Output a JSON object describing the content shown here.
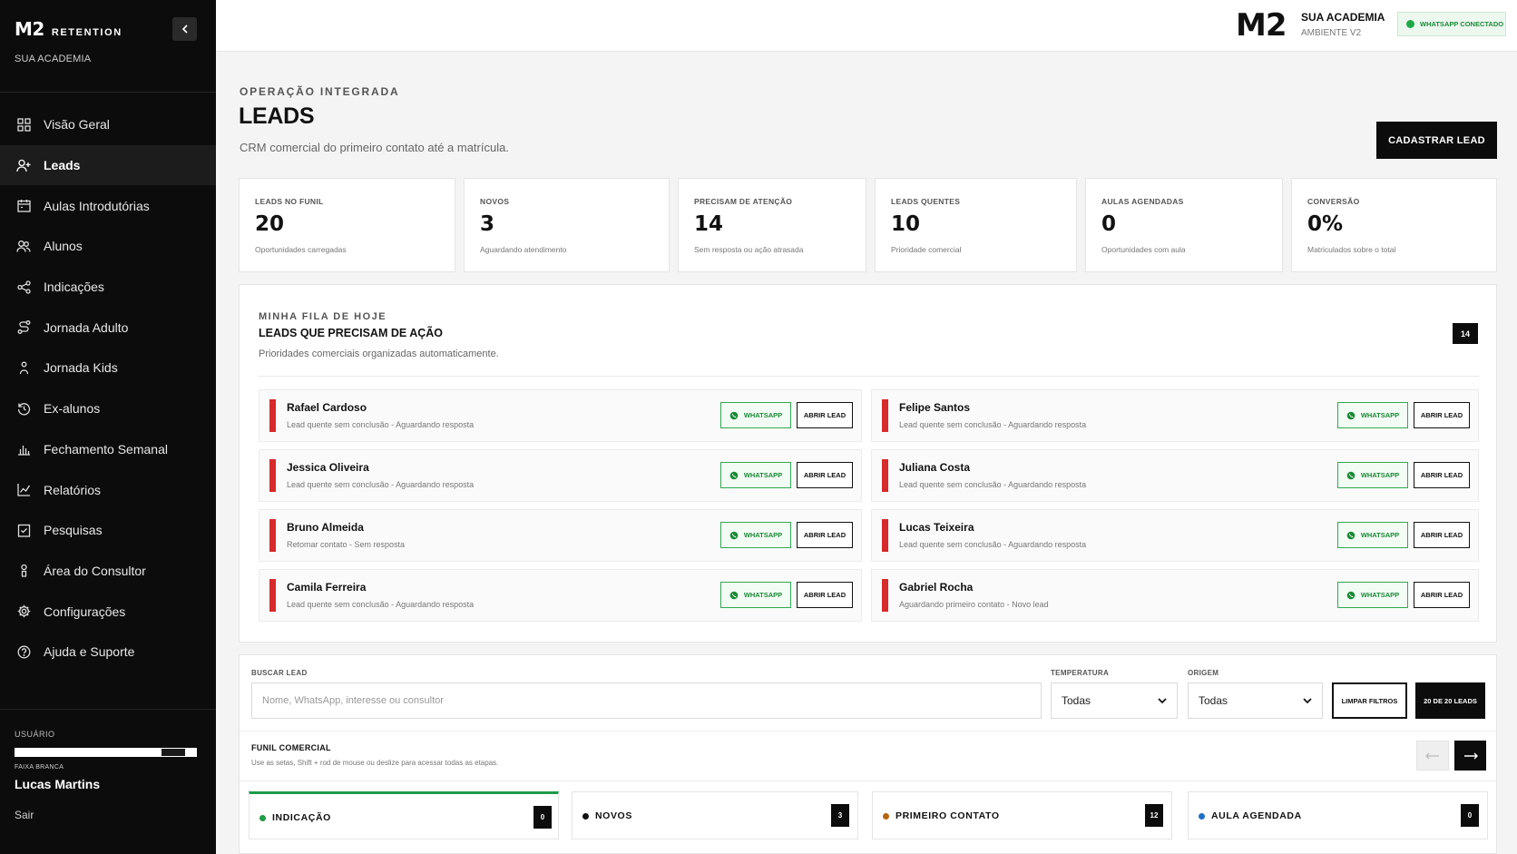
{
  "sidebar": {
    "brand_mark": "M2",
    "brand_word": "RETENTION",
    "academy": "SUA ACADEMIA",
    "items": [
      {
        "label": "Visão Geral",
        "icon": "grid-icon"
      },
      {
        "label": "Leads",
        "icon": "user-plus-icon"
      },
      {
        "label": "Aulas Introdutórias",
        "icon": "calendar-icon"
      },
      {
        "label": "Alunos",
        "icon": "users-icon"
      },
      {
        "label": "Indicações",
        "icon": "share-icon"
      },
      {
        "label": "Jornada Adulto",
        "icon": "route-icon"
      },
      {
        "label": "Jornada Kids",
        "icon": "child-icon"
      },
      {
        "label": "Ex-alunos",
        "icon": "history-icon"
      },
      {
        "label": "Fechamento Semanal",
        "icon": "bar-chart-icon"
      },
      {
        "label": "Relatórios",
        "icon": "line-chart-icon"
      },
      {
        "label": "Pesquisas",
        "icon": "clipboard-check-icon"
      },
      {
        "label": "Área do Consultor",
        "icon": "consultant-icon"
      },
      {
        "label": "Configurações",
        "icon": "gear-icon"
      },
      {
        "label": "Ajuda e Suporte",
        "icon": "help-icon"
      }
    ],
    "active_item": "Leads",
    "user_label": "USUÁRIO",
    "belt_label": "FAIXA BRANCA",
    "user_name": "Lucas Martins",
    "logout": "Sair"
  },
  "topbar": {
    "logo": "M2",
    "academy": "SUA ACADEMIA",
    "environment": "AMBIENTE V2",
    "whatsapp_status": "WHATSAPP CONECTADO"
  },
  "header": {
    "kicker": "OPERAÇÃO INTEGRADA",
    "title": "LEADS",
    "subtitle": "CRM comercial do primeiro contato até a matrícula.",
    "cta": "CADASTRAR LEAD"
  },
  "stats": [
    {
      "label": "LEADS NO FUNIL",
      "value": "20",
      "sub": "Oportunidades carregadas"
    },
    {
      "label": "NOVOS",
      "value": "3",
      "sub": "Aguardando atendimento"
    },
    {
      "label": "PRECISAM DE ATENÇÃO",
      "value": "14",
      "sub": "Sem resposta ou ação atrasada"
    },
    {
      "label": "LEADS QUENTES",
      "value": "10",
      "sub": "Prioridade comercial"
    },
    {
      "label": "AULAS AGENDADAS",
      "value": "0",
      "sub": "Oportunidades com aula"
    },
    {
      "label": "CONVERSÃO",
      "value": "0%",
      "sub": "Matriculados sobre o total"
    }
  ],
  "queue": {
    "kicker": "MINHA FILA DE HOJE",
    "title": "LEADS QUE PRECISAM DE AÇÃO",
    "subtitle": "Prioridades comerciais organizadas automaticamente.",
    "count": "14",
    "whatsapp_label": "WHATSAPP",
    "open_label": "ABRIR LEAD",
    "leads": [
      {
        "name": "Rafael Cardoso",
        "desc": "Lead quente sem conclusão - Aguardando resposta"
      },
      {
        "name": "Felipe Santos",
        "desc": "Lead quente sem conclusão - Aguardando resposta"
      },
      {
        "name": "Jessica Oliveira",
        "desc": "Lead quente sem conclusão - Aguardando resposta"
      },
      {
        "name": "Juliana Costa",
        "desc": "Lead quente sem conclusão - Aguardando resposta"
      },
      {
        "name": "Bruno Almeida",
        "desc": "Retomar contato - Sem resposta"
      },
      {
        "name": "Lucas Teixeira",
        "desc": "Lead quente sem conclusão - Aguardando resposta"
      },
      {
        "name": "Camila Ferreira",
        "desc": "Lead quente sem conclusão - Aguardando resposta"
      },
      {
        "name": "Gabriel Rocha",
        "desc": "Aguardando primeiro contato - Novo lead"
      }
    ]
  },
  "filters": {
    "search_label": "BUSCAR LEAD",
    "search_placeholder": "Nome, WhatsApp, interesse ou consultor",
    "temperature_label": "TEMPERATURA",
    "temperature_value": "Todas",
    "origin_label": "ORIGEM",
    "origin_value": "Todas",
    "clear": "LIMPAR FILTROS",
    "count": "20 DE 20 LEADS"
  },
  "funnel": {
    "title": "FUNIL COMERCIAL",
    "hint": "Use as setas, Shift + rod de mouse ou deslize para acessar todas as etapas.",
    "stages": [
      {
        "name": "INDICAÇÃO",
        "count": "0",
        "color": "#1f9a47"
      },
      {
        "name": "NOVOS",
        "count": "3",
        "color": "#111111"
      },
      {
        "name": "PRIMEIRO CONTATO",
        "count": "12",
        "color": "#b5650f"
      },
      {
        "name": "AULA AGENDADA",
        "count": "0",
        "color": "#1f6fc4"
      }
    ]
  },
  "colors": {
    "accent_green": "#1f9a47",
    "priority_red": "#d72a2a",
    "dark": "#0c0c0c"
  }
}
